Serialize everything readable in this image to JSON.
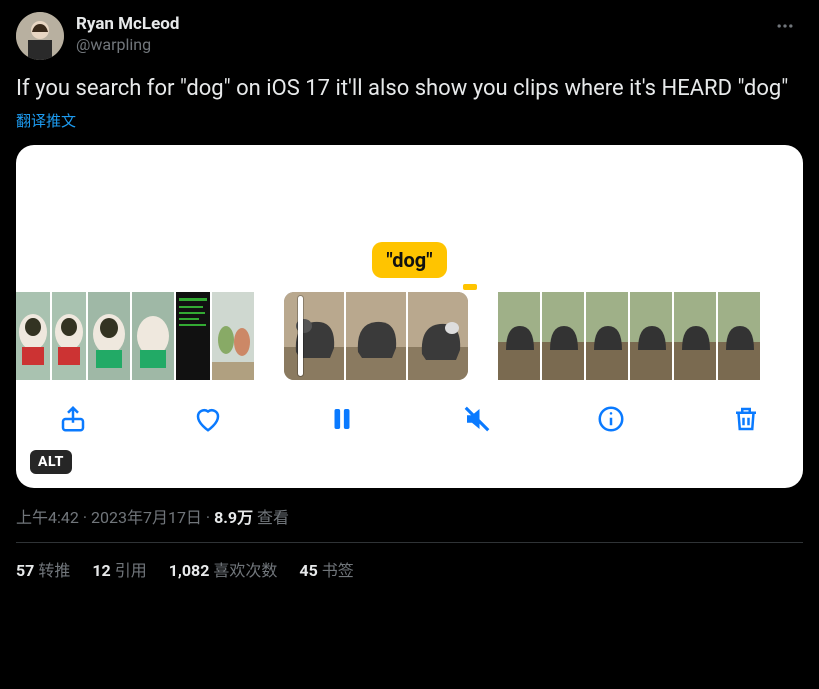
{
  "author": {
    "display_name": "Ryan McLeod",
    "handle": "@warpling"
  },
  "body_text": "If you search for \"dog\" on iOS 17 it'll also show you clips where it's HEARD \"dog\"",
  "translate_label": "翻译推文",
  "media": {
    "search_tag": "\"dog\"",
    "alt_badge": "ALT",
    "icons": {
      "share": "share-icon",
      "heart": "heart-icon",
      "pause": "pause-icon",
      "mute": "mute-icon",
      "info": "info-icon",
      "trash": "trash-icon"
    }
  },
  "meta": {
    "time": "上午4:42",
    "date": "2023年7月17日",
    "views_count": "8.9万",
    "views_label": "查看"
  },
  "stats": {
    "retweets": {
      "count": "57",
      "label": "转推"
    },
    "quotes": {
      "count": "12",
      "label": "引用"
    },
    "likes": {
      "count": "1,082",
      "label": "喜欢次数"
    },
    "bookmarks": {
      "count": "45",
      "label": "书签"
    }
  }
}
